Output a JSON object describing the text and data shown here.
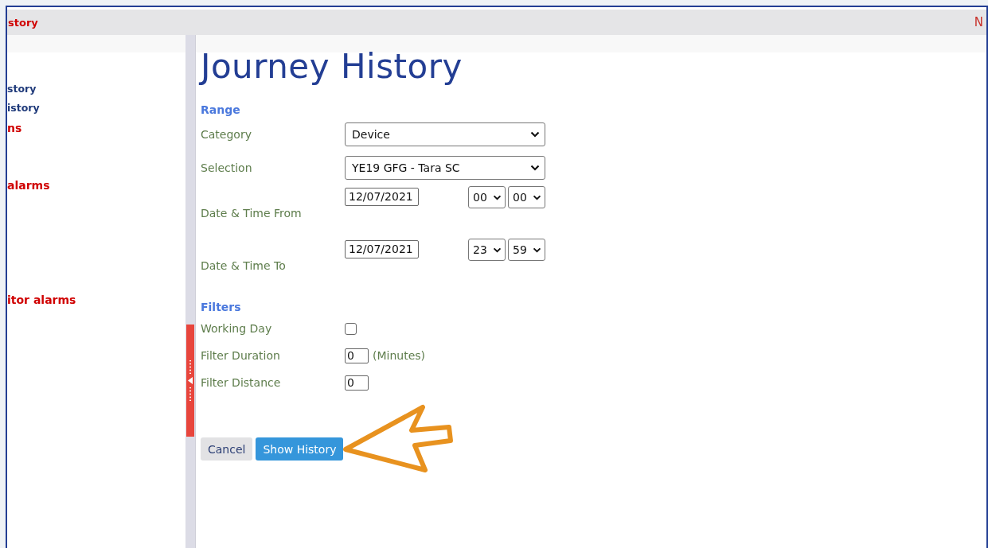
{
  "top_bar": {
    "left_text": "story",
    "right_text": "N"
  },
  "sidebar": {
    "items": [
      {
        "label": "story",
        "color": "#1f3a7a"
      },
      {
        "label": "istory",
        "color": "#1f3a7a"
      },
      {
        "label": "ns",
        "color": "#d00000"
      },
      {
        "label": "alarms",
        "color": "#d00000"
      },
      {
        "label": "itor alarms",
        "color": "#d00000"
      }
    ]
  },
  "page": {
    "title": "Journey History",
    "sections": [
      {
        "heading": "Range",
        "fields": [
          {
            "kind": "select",
            "label": "Category",
            "value": "Device"
          },
          {
            "kind": "select",
            "label": "Selection",
            "value": "YE19 GFG - Tara SC"
          },
          {
            "kind": "datetime",
            "label": "Date & Time From",
            "date": "12/07/2021",
            "hour": "00",
            "minute": "00"
          },
          {
            "kind": "datetime",
            "label": "Date & Time To",
            "date": "12/07/2021",
            "hour": "23",
            "minute": "59"
          }
        ]
      },
      {
        "heading": "Filters",
        "fields": [
          {
            "kind": "checkbox",
            "label": "Working Day",
            "checked": false
          },
          {
            "kind": "number",
            "label": "Filter Duration",
            "value": "0",
            "unit": "(Minutes)"
          },
          {
            "kind": "number",
            "label": "Filter Distance",
            "value": "0"
          }
        ]
      }
    ],
    "buttons": [
      {
        "label": "Cancel",
        "kind": "secondary"
      },
      {
        "label": "Show History",
        "kind": "primary"
      }
    ]
  }
}
